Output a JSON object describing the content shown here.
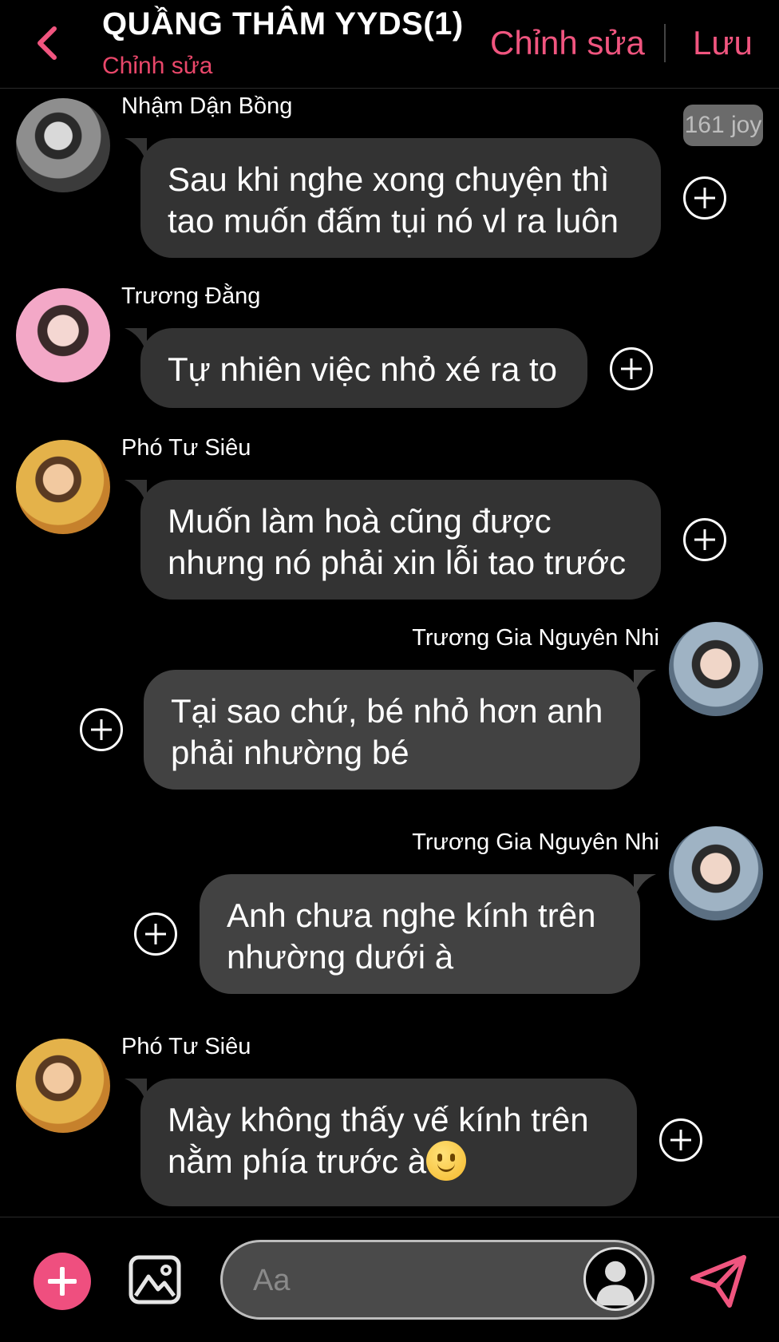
{
  "header": {
    "title": "QUẦNG THÂM YYDS(1)",
    "subtitle": "Chỉnh sửa",
    "edit_label": "Chỉnh sửa",
    "save_label": "Lưu"
  },
  "colors": {
    "accent": "#f0557f",
    "bubble": "#333333",
    "bubble_right": "#424242",
    "background": "#000000"
  },
  "messages": [
    {
      "sender": "Nhậm Dận Bồng",
      "side": "left",
      "lines": [
        "Sau khi nghe xong chuyện thì",
        "tao muốn đấm tụi nó vl ra luôn"
      ],
      "badge": "161 joy"
    },
    {
      "sender": "Trương Đằng",
      "side": "left",
      "lines": [
        "Tự nhiên việc nhỏ xé ra to"
      ]
    },
    {
      "sender": "Phó Tư Siêu",
      "side": "left",
      "lines": [
        "Muốn làm hoà cũng được",
        "nhưng nó phải xin lỗi tao trước"
      ]
    },
    {
      "sender": "Trương Gia Nguyên Nhi",
      "side": "right",
      "lines": [
        "Tại sao chứ, bé nhỏ hơn anh",
        "phải nhường bé"
      ]
    },
    {
      "sender": "Trương Gia Nguyên Nhi",
      "side": "right",
      "lines": [
        "Anh chưa nghe kính trên",
        "nhường dưới à"
      ]
    },
    {
      "sender": "Phó Tư Siêu",
      "side": "left",
      "lines": [
        "Mày không thấy vế kính trên",
        "nằm phía trước à"
      ],
      "emoji": "slightly-smiling-face"
    }
  ],
  "composer": {
    "placeholder": "Aa"
  },
  "icons": {
    "back": "chevron-left-icon",
    "add": "plus-icon",
    "image": "image-icon",
    "send": "send-icon",
    "react": "add-reaction-icon"
  }
}
